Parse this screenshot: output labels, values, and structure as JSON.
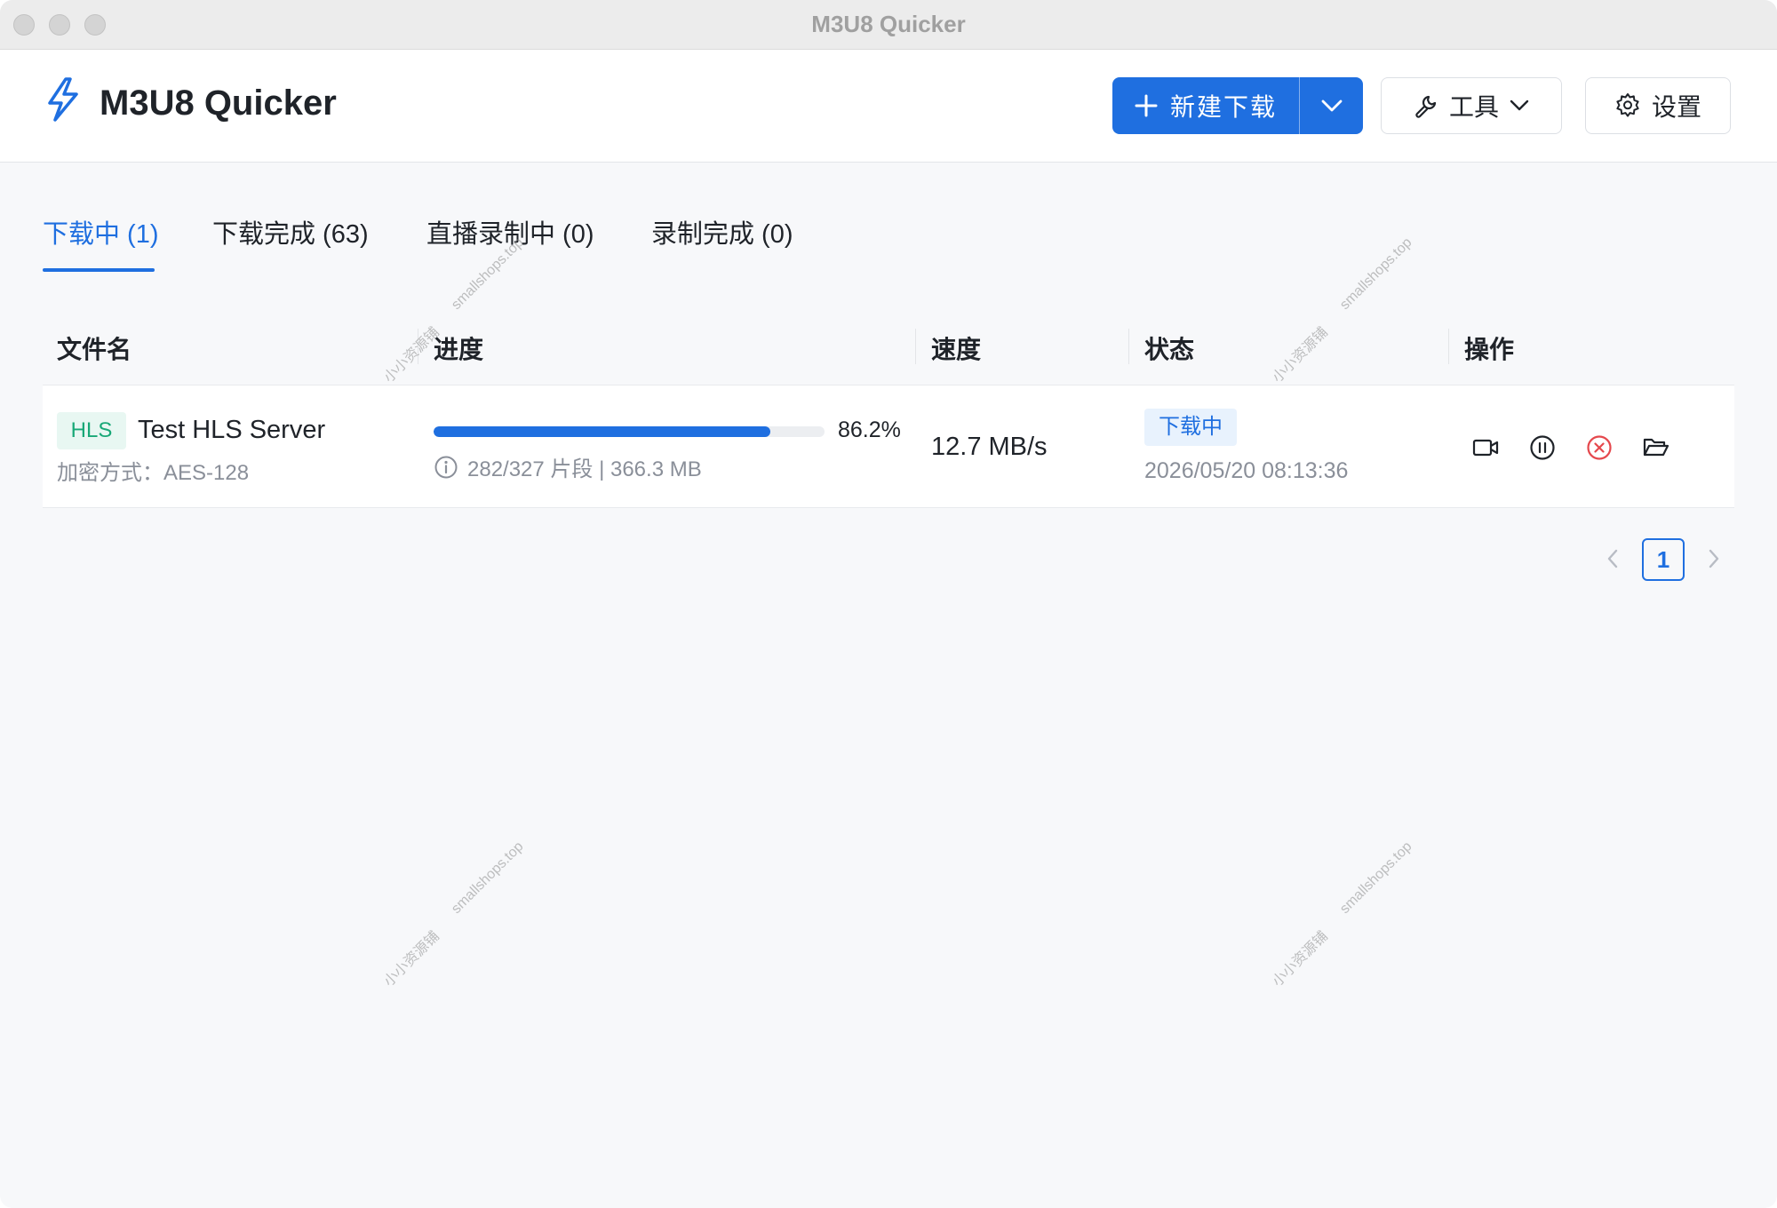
{
  "window": {
    "title": "M3U8 Quicker"
  },
  "header": {
    "app_name": "M3U8 Quicker",
    "new_download_label": "新建下载",
    "tools_label": "工具",
    "settings_label": "设置"
  },
  "tabs": [
    {
      "label": "下载中 (1)",
      "active": true
    },
    {
      "label": "下载完成 (63)",
      "active": false
    },
    {
      "label": "直播录制中 (0)",
      "active": false
    },
    {
      "label": "录制完成 (0)",
      "active": false
    }
  ],
  "table": {
    "columns": [
      "文件名",
      "进度",
      "速度",
      "状态",
      "操作"
    ],
    "rows": [
      {
        "type_tag": "HLS",
        "name": "Test HLS Server",
        "encryption": "加密方式：AES-128",
        "progress_percent": 86.2,
        "progress_label": "86.2%",
        "segments_info": "282/327 片段 | 366.3 MB",
        "speed": "12.7 MB/s",
        "status": "下载中",
        "time": "2026/05/20 08:13:36"
      }
    ]
  },
  "pagination": {
    "current_page": "1"
  },
  "watermarks": {
    "site": "smallshops.top",
    "shop": "小小资源铺"
  },
  "icons": {
    "logo": "lightning-icon",
    "new": "plus-icon",
    "dropdown": "chevron-down-icon",
    "tools": "wrench-icon",
    "settings": "gear-icon",
    "info": "info-icon",
    "ops": [
      "video-icon",
      "pause-icon",
      "cancel-icon",
      "folder-open-icon"
    ]
  },
  "colors": {
    "primary": "#1f6fe0",
    "success_tag": "#18a877",
    "danger": "#e5484d",
    "muted_text": "#8a8f99"
  }
}
